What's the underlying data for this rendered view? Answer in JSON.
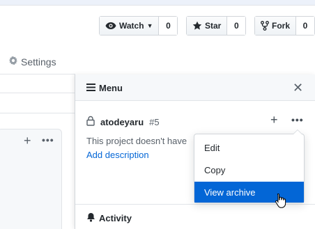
{
  "header": {
    "watch": {
      "label": "Watch",
      "count": "0"
    },
    "star": {
      "label": "Star",
      "count": "0"
    },
    "fork": {
      "label": "Fork",
      "count": "0"
    }
  },
  "nav": {
    "settings_label": "Settings"
  },
  "menu": {
    "title": "Menu",
    "project": {
      "owner": "atodeyaru",
      "number": "#5"
    },
    "description": "This project doesn't have",
    "add_description": "Add description",
    "activity_label": "Activity"
  },
  "dropdown": {
    "items": [
      {
        "label": "Edit"
      },
      {
        "label": "Copy"
      },
      {
        "label": "View archive"
      }
    ],
    "active_index": 2
  },
  "colors": {
    "accent": "#0366d6",
    "text": "#24292e",
    "muted": "#586069"
  }
}
